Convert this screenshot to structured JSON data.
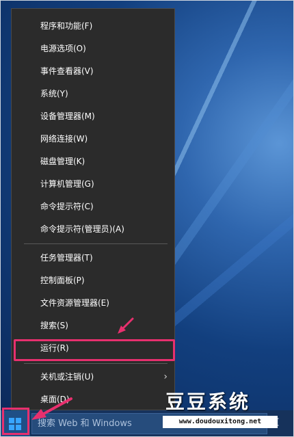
{
  "menu": {
    "items": [
      {
        "label": "程序和功能(F)"
      },
      {
        "label": "电源选项(O)"
      },
      {
        "label": "事件查看器(V)"
      },
      {
        "label": "系统(Y)"
      },
      {
        "label": "设备管理器(M)"
      },
      {
        "label": "网络连接(W)"
      },
      {
        "label": "磁盘管理(K)"
      },
      {
        "label": "计算机管理(G)"
      },
      {
        "label": "命令提示符(C)"
      },
      {
        "label": "命令提示符(管理员)(A)"
      },
      {
        "label": "任务管理器(T)"
      },
      {
        "label": "控制面板(P)"
      },
      {
        "label": "文件资源管理器(E)"
      },
      {
        "label": "搜索(S)"
      },
      {
        "label": "运行(R)"
      },
      {
        "label": "关机或注销(U)"
      },
      {
        "label": "桌面(D)"
      }
    ],
    "submenu_arrow": "›"
  },
  "taskbar": {
    "search_placeholder": "搜索 Web 和 Windows",
    "start_icon": "windows-logo-icon"
  },
  "watermark": {
    "title": "豆豆系统",
    "url": "www.doudouxitong.net"
  },
  "colors": {
    "highlight": "#e7306e",
    "menu_bg": "#2b2b2b",
    "taskbar_bg": "#16325b"
  }
}
